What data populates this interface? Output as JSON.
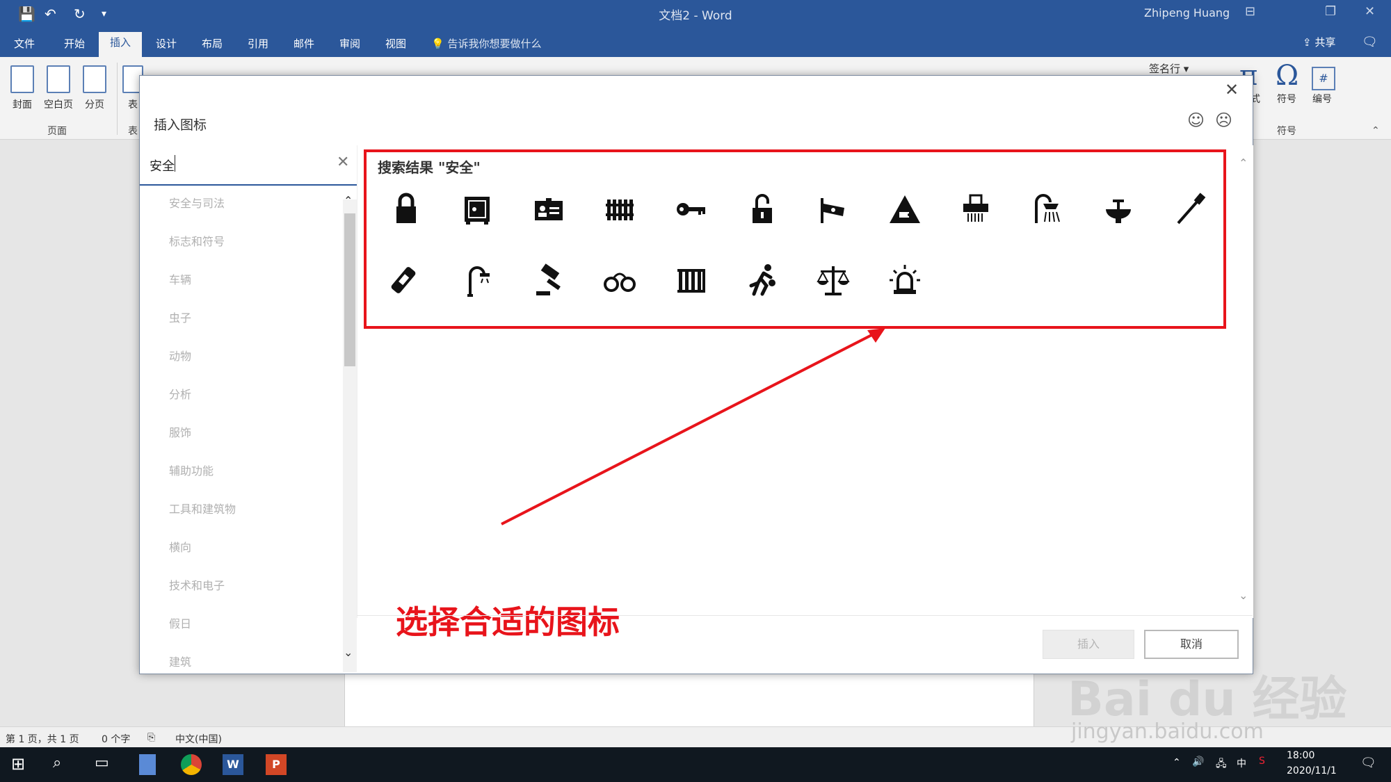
{
  "window": {
    "title": "文档2  -  Word",
    "user": "Zhipeng Huang",
    "quick_access": [
      "save-icon",
      "undo-icon",
      "redo-icon",
      "customize-icon"
    ]
  },
  "tabs": [
    {
      "label": "文件",
      "active": false
    },
    {
      "label": "开始",
      "active": false
    },
    {
      "label": "插入",
      "active": true
    },
    {
      "label": "设计",
      "active": false
    },
    {
      "label": "布局",
      "active": false
    },
    {
      "label": "引用",
      "active": false
    },
    {
      "label": "邮件",
      "active": false
    },
    {
      "label": "审阅",
      "active": false
    },
    {
      "label": "视图",
      "active": false
    }
  ],
  "tell_me": "告诉我你想要做什么",
  "share_label": "共享",
  "ribbon": {
    "pages_group": {
      "label": "页面",
      "buttons": [
        "封面",
        "空白页",
        "分页"
      ]
    },
    "table_label": "表",
    "signature_line": "签名行",
    "symbols_group": {
      "label": "符号",
      "buttons": [
        "式",
        "符号",
        "编号"
      ]
    }
  },
  "dialog": {
    "title": "插入图标",
    "search_value": "安全",
    "categories": [
      "安全与司法",
      "标志和符号",
      "车辆",
      "虫子",
      "动物",
      "分析",
      "服饰",
      "辅助功能",
      "工具和建筑物",
      "横向",
      "技术和电子",
      "假日",
      "建筑"
    ],
    "results_title": "搜索结果 \"安全\"",
    "icons_row1": [
      "lock-icon",
      "safe-icon",
      "id-badge-icon",
      "fence-icon",
      "key-icon",
      "unlock-icon",
      "security-camera-icon",
      "camera-warning-icon",
      "shredder-icon",
      "shower-icon",
      "sink-icon",
      "toothbrush-icon"
    ],
    "icons_row2": [
      "toothpaste-icon",
      "street-lamp-icon",
      "gavel-icon",
      "handcuffs-icon",
      "jail-icon",
      "running-thief-icon",
      "scales-icon",
      "siren-icon"
    ],
    "insert_label": "插入",
    "cancel_label": "取消"
  },
  "annotation": "选择合适的图标",
  "statusbar": {
    "page": "第 1 页，共 1 页",
    "words": "0 个字",
    "language": "中文(中国)"
  },
  "taskbar": {
    "time": "18:00",
    "date": "2020/11/1",
    "ime": "中"
  },
  "watermark": "Bai du 经验",
  "watermark_url": "jingyan.baidu.com",
  "colors": {
    "title_bar": "#2b579a",
    "annotation_red": "#e8141b",
    "taskbar": "#101820"
  }
}
